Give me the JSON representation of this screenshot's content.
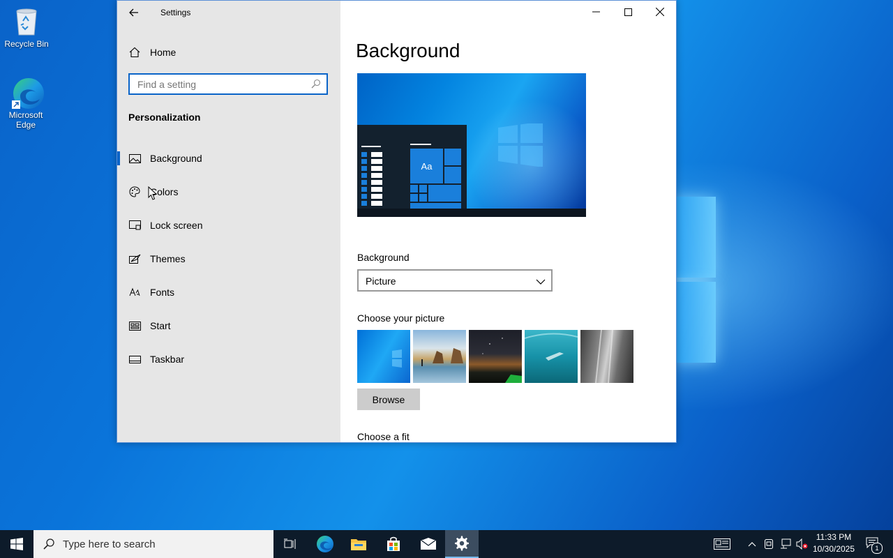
{
  "desktop": {
    "icons": [
      {
        "label": "Recycle Bin"
      },
      {
        "label": "Microsoft Edge"
      }
    ]
  },
  "window": {
    "title": "Settings",
    "sidebar": {
      "home_label": "Home",
      "search_placeholder": "Find a setting",
      "section_title": "Personalization",
      "items": [
        {
          "label": "Background",
          "icon": "picture-icon",
          "active": true
        },
        {
          "label": "Colors",
          "icon": "palette-icon"
        },
        {
          "label": "Lock screen",
          "icon": "lock-screen-icon"
        },
        {
          "label": "Themes",
          "icon": "themes-icon"
        },
        {
          "label": "Fonts",
          "icon": "fonts-icon"
        },
        {
          "label": "Start",
          "icon": "start-icon"
        },
        {
          "label": "Taskbar",
          "icon": "taskbar-icon"
        }
      ]
    },
    "main": {
      "page_title": "Background",
      "preview_tile_text": "Aa",
      "background_label": "Background",
      "background_value": "Picture",
      "choose_picture_label": "Choose your picture",
      "pictures": [
        "windows-blue",
        "beach-rocks",
        "night-sky-tent",
        "underwater-swimmer",
        "rock-cliff"
      ],
      "browse_label": "Browse",
      "choose_fit_label": "Choose a fit"
    }
  },
  "taskbar": {
    "search_placeholder": "Type here to search",
    "apps": [
      "task-view",
      "edge",
      "file-explorer",
      "store",
      "mail",
      "settings"
    ],
    "active_app": "settings",
    "clock_time": "11:33 PM",
    "clock_date": "10/30/2025",
    "notification_count": "1"
  },
  "colors": {
    "accent": "#0a64c8",
    "sidebar_bg": "#e6e6e6",
    "taskbar_bg": "#0d1b2a"
  }
}
